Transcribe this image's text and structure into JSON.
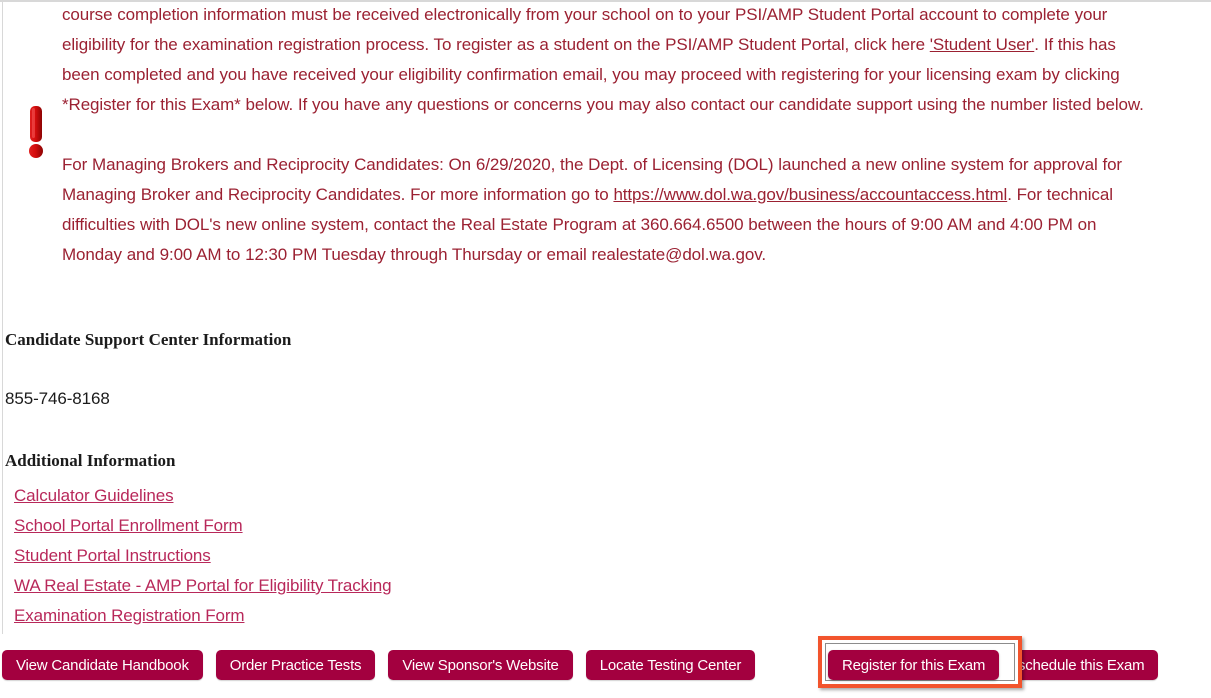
{
  "alert": {
    "icon": "exclamation-mark-icon",
    "paragraph_1": "course completion information must be received electronically from your school on to your PSI/AMP Student Portal account to complete your eligibility for the examination registration process. To register as a student on the PSI/AMP Student Portal, click here ",
    "paragraph_1_link": "'Student User'",
    "paragraph_1_tail": ". If this has been completed and you have received your eligibility confirmation email, you may proceed with registering for your licensing exam by clicking *Register for this Exam* below. If you have any questions or concerns you may also contact our candidate support using the number listed below.",
    "paragraph_2_head": "For Managing Brokers and Reciprocity Candidates: On 6/29/2020, the Dept. of Licensing (DOL) launched a new online system for approval for Managing Broker and Reciprocity Candidates. For more information go to ",
    "paragraph_2_link": "https://www.dol.wa.gov/business/accountaccess.html",
    "paragraph_2_tail": ". For technical difficulties with DOL's new online system, contact the Real Estate Program at 360.664.6500 between the hours of 9:00 AM and 4:00 PM on Monday and 9:00 AM to 12:30 PM Tuesday through Thursday or email realestate@dol.wa.gov.",
    "text_color": "#9b2132"
  },
  "support": {
    "heading": "Candidate Support Center Information",
    "phone": "855-746-8168"
  },
  "additional": {
    "heading": "Additional Information",
    "link_color": "#b8285a",
    "links": [
      {
        "label": "Calculator Guidelines"
      },
      {
        "label": "School Portal Enrollment Form"
      },
      {
        "label": "Student Portal Instructions"
      },
      {
        "label": "WA Real Estate - AMP Portal for Eligibility Tracking"
      },
      {
        "label": "Examination Registration Form"
      }
    ]
  },
  "buttons": {
    "background_color": "#a3003f",
    "highlight_color": "#f2542d",
    "items": [
      {
        "label": "View Candidate Handbook"
      },
      {
        "label": "Order Practice Tests"
      },
      {
        "label": "View Sponsor's Website"
      },
      {
        "label": "Locate Testing Center"
      },
      {
        "label": "Register for this Exam"
      },
      {
        "label": "Reschedule this Exam"
      }
    ],
    "highlighted": "Register for this Exam"
  }
}
